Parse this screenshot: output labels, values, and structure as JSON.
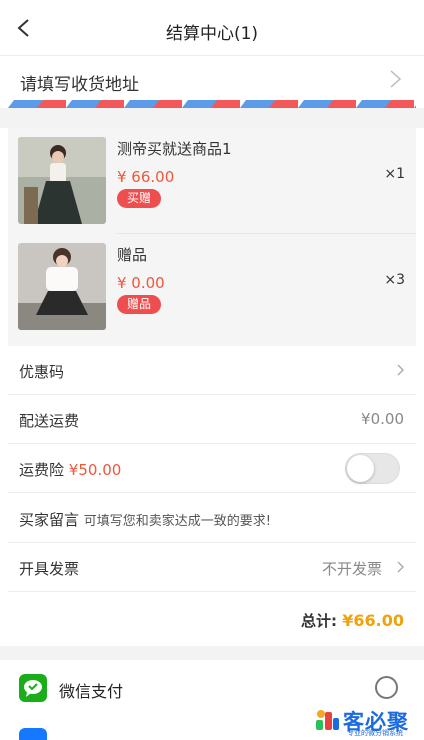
{
  "header": {
    "title": "结算中心(1)"
  },
  "address": {
    "label": "请填写收货地址"
  },
  "goods": [
    {
      "name": "测帝买就送商品1",
      "price": "¥ 66.00",
      "badge": "买赠",
      "qty": "×1"
    },
    {
      "name": "赠品",
      "price": "¥ 0.00",
      "badge": "赠品",
      "qty": "×3"
    }
  ],
  "rows": {
    "coupon": {
      "label": "优惠码"
    },
    "shipping": {
      "label": "配送运费",
      "value": "¥0.00"
    },
    "insurance": {
      "label": "运费险",
      "amount": "¥50.00",
      "enabled": false
    },
    "message": {
      "label": "买家留言",
      "placeholder": "可填写您和卖家达成一致的要求!"
    },
    "invoice": {
      "label": "开具发票",
      "value": "不开发票"
    }
  },
  "summary": {
    "total_label": "总计:",
    "total_value": "¥66.00"
  },
  "payment": {
    "methods": [
      {
        "label": "微信支付",
        "selected": false
      }
    ]
  },
  "watermark": {
    "text": "客必聚",
    "sub": "专业的微分销系统"
  },
  "colors": {
    "accent": "#f0573b",
    "total": "#f0a20b",
    "wechat": "#1aad19",
    "badge": "#ef4e4e"
  }
}
